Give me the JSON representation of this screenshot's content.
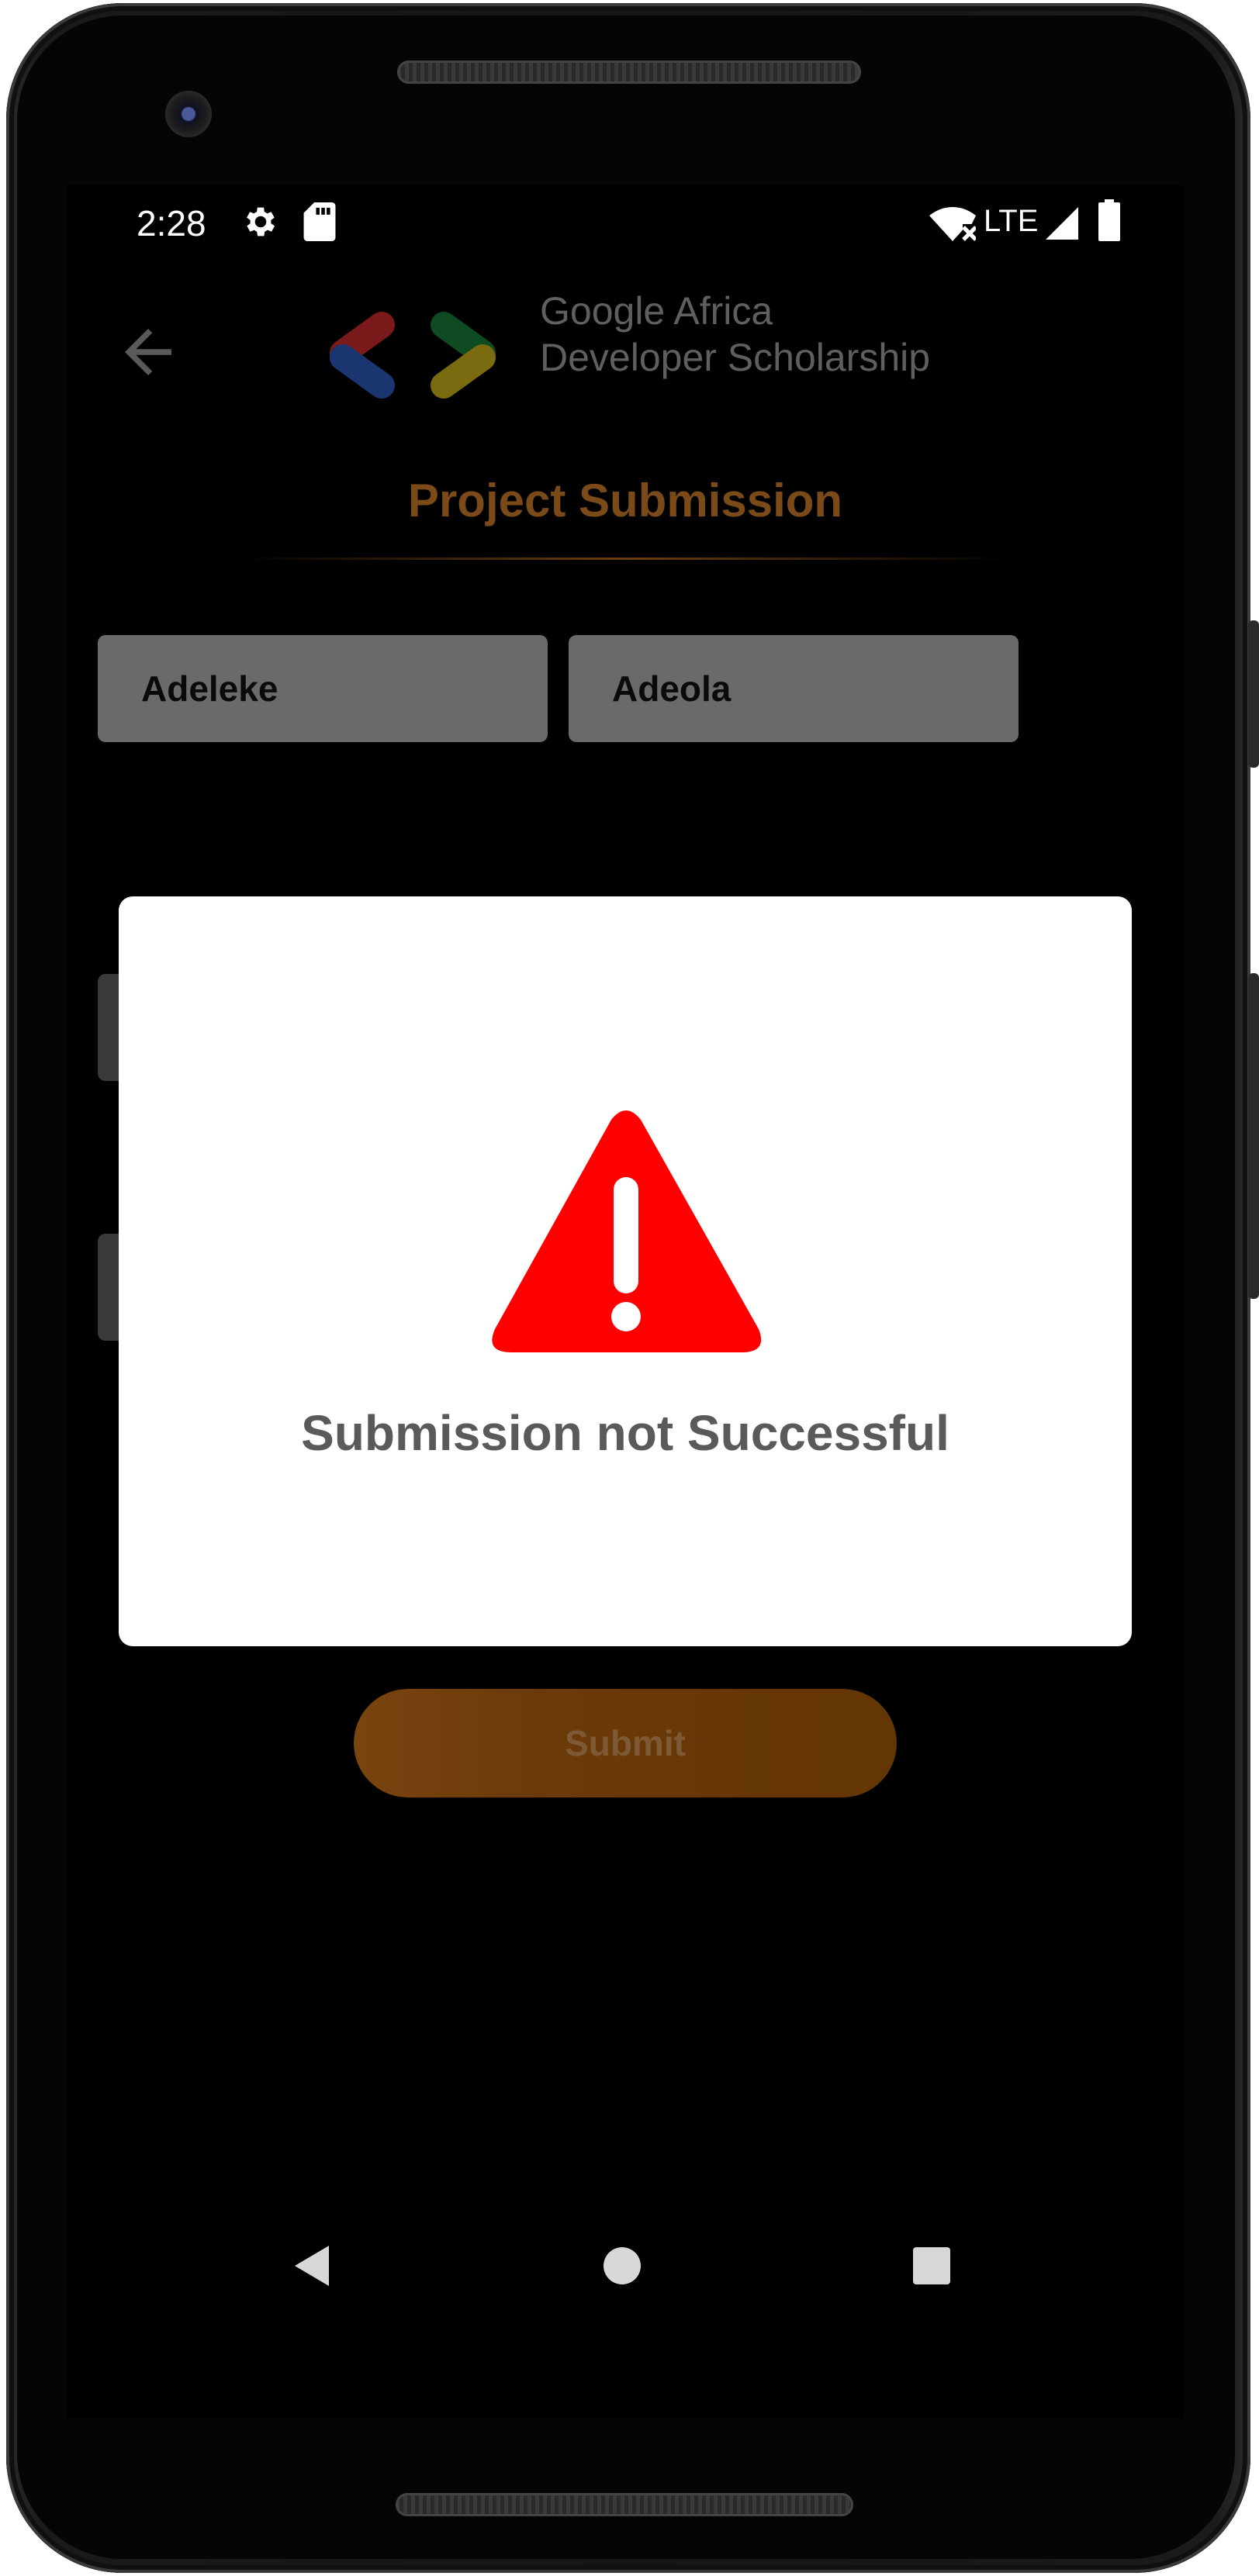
{
  "status_bar": {
    "time": "2:28",
    "network_label": "LTE",
    "icons": [
      "settings-icon",
      "sd-card-icon",
      "wifi-off-icon",
      "signal-icon",
      "battery-icon"
    ]
  },
  "header": {
    "logo_line_1": "Google Africa",
    "logo_line_2": "Developer Scholarship",
    "title": "Project Submission"
  },
  "form": {
    "first_name": "Adeleke",
    "last_name": "Adeola",
    "submit_label": "Submit"
  },
  "dialog": {
    "icon": "warning-icon",
    "message": "Submission not Successful"
  },
  "nav_bar": {
    "icons": [
      "nav-back-icon",
      "nav-home-icon",
      "nav-recents-icon"
    ]
  },
  "colors": {
    "title": "#7a4a18",
    "warning_red": "#ff0000",
    "submit_bg": "#6a3a08",
    "dialog_text": "#5a5a5a"
  }
}
